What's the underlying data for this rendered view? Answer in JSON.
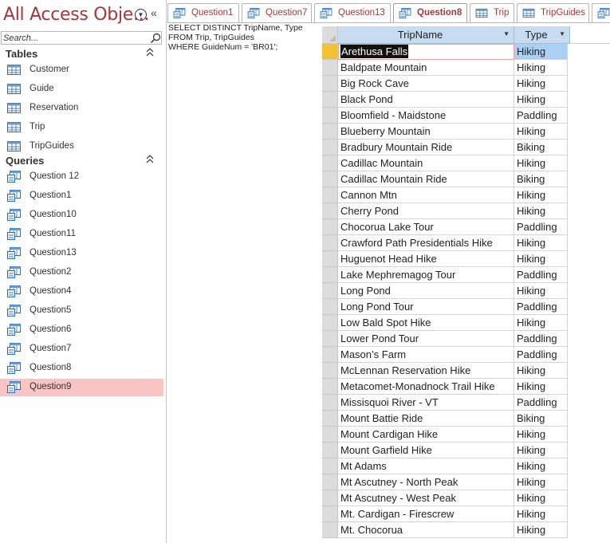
{
  "nav": {
    "title": "All Access Obje...",
    "search_placeholder": "Search...",
    "groups": [
      {
        "label": "Tables",
        "icon": "table-icon",
        "items": [
          "Customer",
          "Guide",
          "Reservation",
          "Trip",
          "TripGuides"
        ]
      },
      {
        "label": "Queries",
        "icon": "query-icon",
        "items": [
          "Question 12",
          "Question1",
          "Question10",
          "Question11",
          "Question13",
          "Question2",
          "Question4",
          "Question5",
          "Question6",
          "Question7",
          "Question8",
          "Question9"
        ]
      }
    ],
    "selected_item": "Question9"
  },
  "tabs": [
    {
      "label": "Question1",
      "icon": "query-icon"
    },
    {
      "label": "Question7",
      "icon": "query-icon"
    },
    {
      "label": "Question13",
      "icon": "query-icon"
    },
    {
      "label": "Question8",
      "icon": "query-icon",
      "active": true
    },
    {
      "label": "Trip",
      "icon": "table-icon"
    },
    {
      "label": "TripGuides",
      "icon": "table-icon"
    },
    {
      "label": "Q",
      "icon": "query-icon"
    }
  ],
  "sql": {
    "text": "SELECT DISTINCT TripName, Type\nFROM Trip, TripGuides\nWHERE GuideNum = 'BR01';"
  },
  "datasheet": {
    "columns": [
      {
        "label": "TripName"
      },
      {
        "label": "Type"
      }
    ],
    "rows": [
      [
        "Arethusa Falls",
        "Hiking"
      ],
      [
        "Baldpate Mountain",
        "Hiking"
      ],
      [
        "Big Rock Cave",
        "Hiking"
      ],
      [
        "Black Pond",
        "Hiking"
      ],
      [
        "Bloomfield - Maidstone",
        "Paddling"
      ],
      [
        "Blueberry Mountain",
        "Hiking"
      ],
      [
        "Bradbury Mountain Ride",
        "Biking"
      ],
      [
        "Cadillac Mountain",
        "Hiking"
      ],
      [
        "Cadillac Mountain Ride",
        "Biking"
      ],
      [
        "Cannon Mtn",
        "Hiking"
      ],
      [
        "Cherry Pond",
        "Hiking"
      ],
      [
        "Chocorua Lake Tour",
        "Paddling"
      ],
      [
        "Crawford Path Presidentials Hike",
        "Hiking"
      ],
      [
        "Huguenot Head Hike",
        "Hiking"
      ],
      [
        "Lake Mephremagog Tour",
        "Paddling"
      ],
      [
        "Long Pond",
        "Hiking"
      ],
      [
        "Long Pond Tour",
        "Paddling"
      ],
      [
        "Low Bald Spot Hike",
        "Hiking"
      ],
      [
        "Lower Pond Tour",
        "Paddling"
      ],
      [
        "Mason’s Farm",
        "Paddling"
      ],
      [
        "McLennan Reservation Hike",
        "Hiking"
      ],
      [
        "Metacomet-Monadnock Trail Hike",
        "Hiking"
      ],
      [
        "Missisquoi River - VT",
        "Paddling"
      ],
      [
        "Mount Battie Ride",
        "Biking"
      ],
      [
        "Mount Cardigan Hike",
        "Hiking"
      ],
      [
        "Mount Garfield Hike",
        "Hiking"
      ],
      [
        "Mt Adams",
        "Hiking"
      ],
      [
        "Mt Ascutney - North Peak",
        "Hiking"
      ],
      [
        "Mt Ascutney - West Peak",
        "Hiking"
      ],
      [
        "Mt. Cardigan - Firescrew",
        "Hiking"
      ],
      [
        "Mt. Chocorua",
        "Hiking"
      ]
    ],
    "current_row": 0
  },
  "colors": {
    "accent": "#a4373a",
    "selected_nav": "#f8c4c4",
    "header_blue": "#c7dcf0",
    "current_record": "#f2c230",
    "selected_cell": "#a9d0f5"
  }
}
